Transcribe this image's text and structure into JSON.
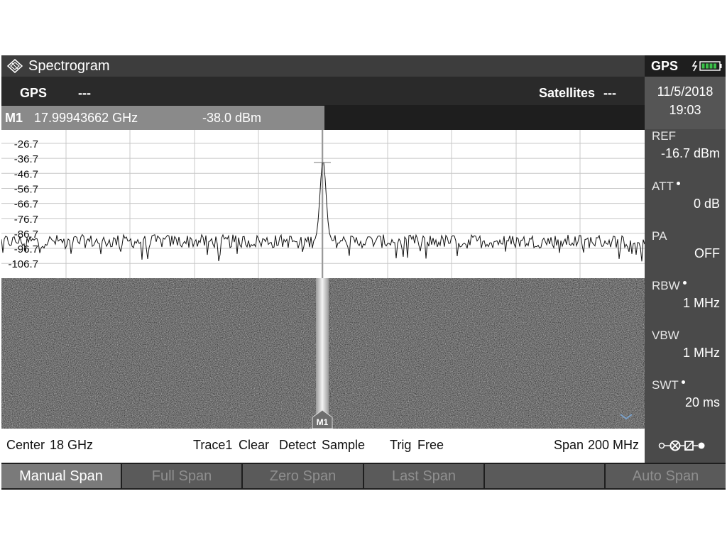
{
  "titlebar": {
    "title": "Spectrogram"
  },
  "gps_status": {
    "label": "GPS",
    "value": "---",
    "satellites_label": "Satellites",
    "satellites_value": "---"
  },
  "marker": {
    "name": "M1",
    "frequency": "17.99943662 GHz",
    "level": "-38.0 dBm"
  },
  "right_panel": {
    "gps_label": "GPS",
    "date": "11/5/2018",
    "time": "19:03",
    "ref_label": "REF",
    "ref_value": "-16.7 dBm",
    "att_label": "ATT",
    "att_value": "0 dB",
    "pa_label": "PA",
    "pa_value": "OFF",
    "rbw_label": "RBW",
    "rbw_value": "1 MHz",
    "vbw_label": "VBW",
    "vbw_value": "1 MHz",
    "swt_label": "SWT",
    "swt_value": "20 ms"
  },
  "statusbar": {
    "center_label": "Center",
    "center_value": "18 GHz",
    "trace_label": "Trace1",
    "trace_value": "Clear",
    "detect_label": "Detect",
    "detect_value": "Sample",
    "trig_label": "Trig",
    "trig_value": "Free",
    "span_label": "Span",
    "span_value": "200 MHz"
  },
  "softkeys": [
    {
      "label": "Manual Span",
      "active": true
    },
    {
      "label": "Full Span",
      "active": false
    },
    {
      "label": "Zero Span",
      "active": false
    },
    {
      "label": "Last Span",
      "active": false
    },
    {
      "label": "",
      "active": false
    },
    {
      "label": "Auto Span",
      "active": false
    }
  ],
  "chart_data": {
    "type": "line",
    "y_tick_labels": [
      "-26.7",
      "-36.7",
      "-46.7",
      "-56.7",
      "-66.7",
      "-76.7",
      "-86.7",
      "-96.7",
      "-106.7"
    ],
    "ylim": [
      -116.7,
      -16.7
    ],
    "y_unit": "dBm",
    "x_center": "18 GHz",
    "x_span": "200 MHz",
    "noise_floor": -92,
    "peak": {
      "x_fraction": 0.5,
      "y": -38.0
    },
    "marker_label": "M1",
    "grid": true
  },
  "colors": {
    "trace": "#111111",
    "grid": "#c8c8c8",
    "marker_line": "#9a9a9a",
    "waterfall": "#8c8c8c"
  }
}
